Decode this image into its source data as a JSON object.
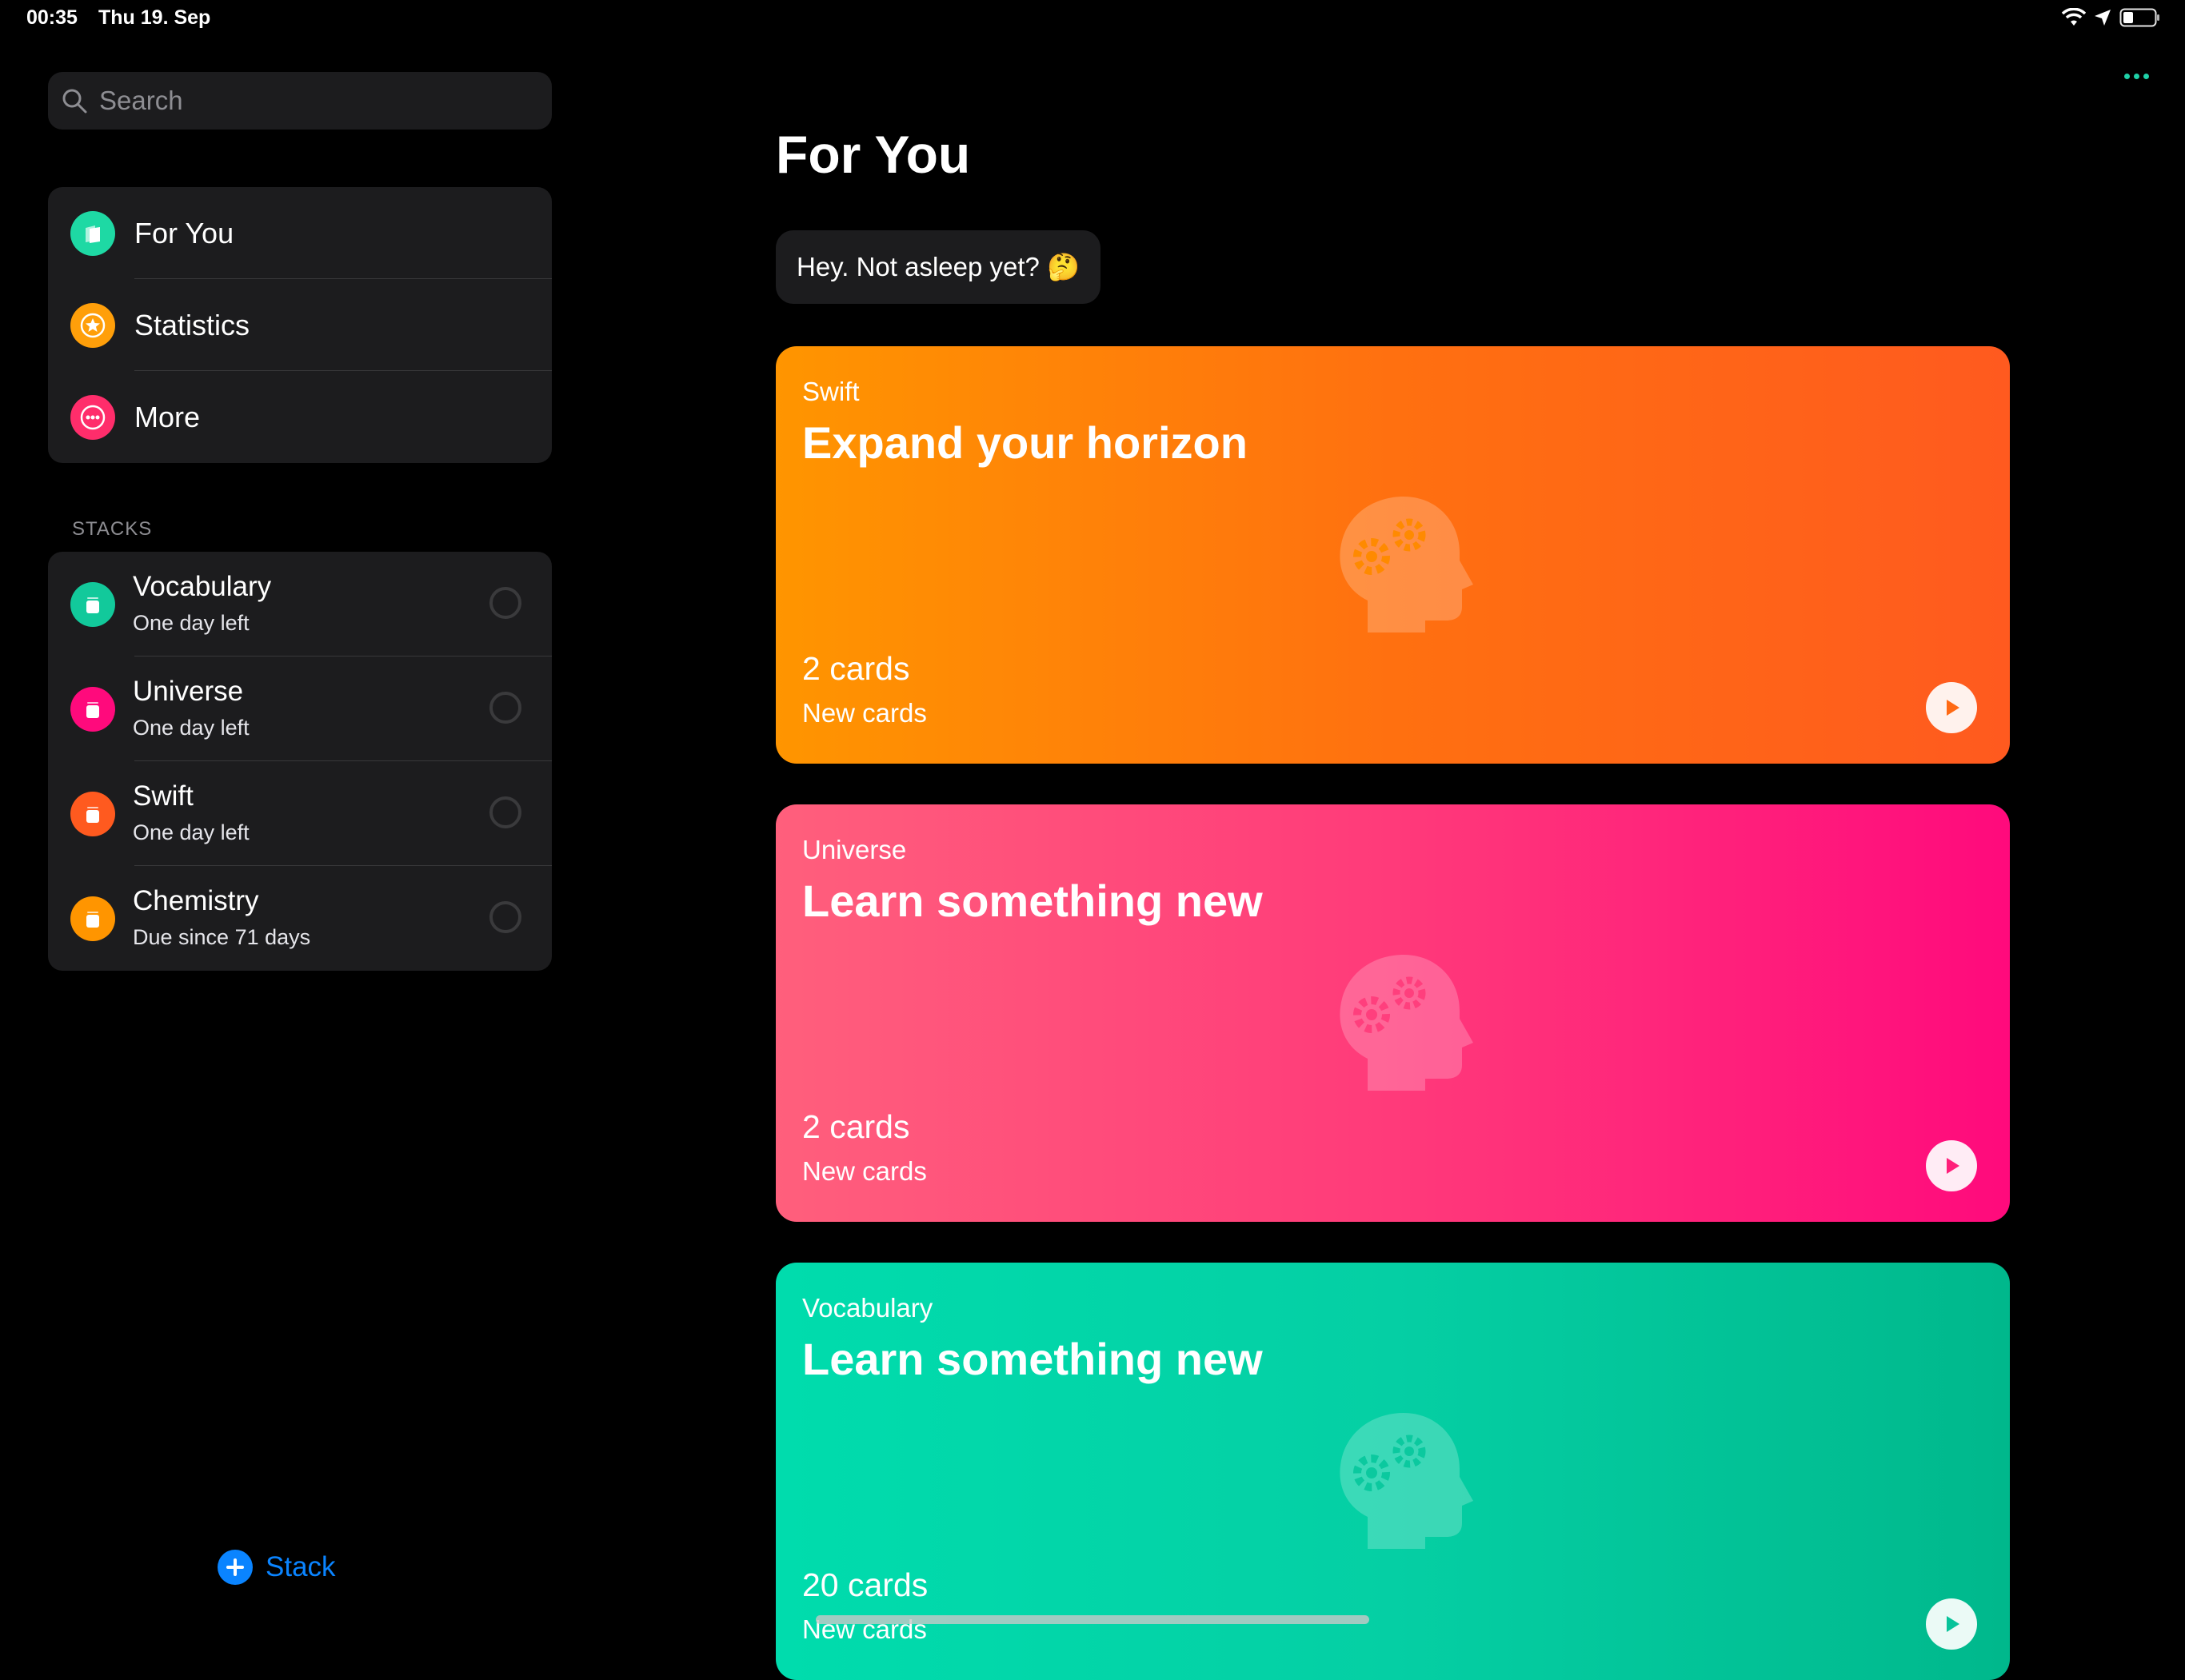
{
  "status_bar": {
    "time": "00:35",
    "date": "Thu 19. Sep"
  },
  "sidebar": {
    "search_placeholder": "Search",
    "nav": [
      {
        "label": "For You",
        "icon": "cards-icon",
        "color": "#1ed9a4"
      },
      {
        "label": "Statistics",
        "icon": "star-icon",
        "color": "#ff9f0a"
      },
      {
        "label": "More",
        "icon": "ellipsis-icon",
        "color": "#ff2d6b"
      }
    ],
    "stacks_header": "STACKS",
    "stacks": [
      {
        "name": "Vocabulary",
        "subtitle": "One day left",
        "color": "#12c99b"
      },
      {
        "name": "Universe",
        "subtitle": "One day left",
        "color": "#ff0a7c"
      },
      {
        "name": "Swift",
        "subtitle": "One day left",
        "color": "#ff5a1f"
      },
      {
        "name": "Chemistry",
        "subtitle": "Due since 71 days",
        "color": "#ff9500"
      }
    ],
    "add_stack_label": "Stack",
    "accent_color": "#0a84ff"
  },
  "main": {
    "title": "For You",
    "greeting": "Hey. Not asleep yet? 🤔",
    "cards": [
      {
        "stack": "Swift",
        "headline": "Expand your horizon",
        "count": "2 cards",
        "subtitle": "New cards"
      },
      {
        "stack": "Universe",
        "headline": "Learn something new",
        "count": "2 cards",
        "subtitle": "New cards"
      },
      {
        "stack": "Vocabulary",
        "headline": "Learn something new",
        "count": "20 cards",
        "subtitle": "New cards"
      }
    ]
  }
}
